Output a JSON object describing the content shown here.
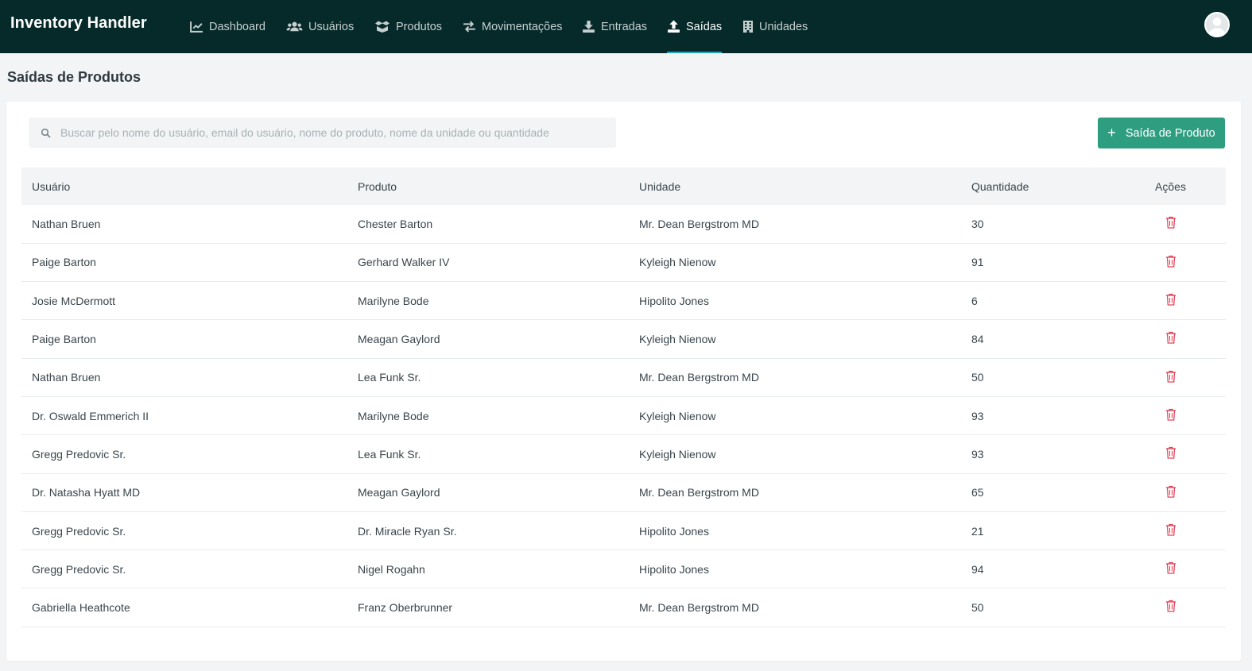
{
  "app": {
    "title": "Inventory Handler"
  },
  "nav": [
    {
      "label": "Dashboard",
      "icon": "chart-line-icon",
      "active": false
    },
    {
      "label": "Usuários",
      "icon": "users-icon",
      "active": false
    },
    {
      "label": "Produtos",
      "icon": "boxes-icon",
      "active": false
    },
    {
      "label": "Movimentações",
      "icon": "exchange-icon",
      "active": false
    },
    {
      "label": "Entradas",
      "icon": "download-icon",
      "active": false
    },
    {
      "label": "Saídas",
      "icon": "upload-icon",
      "active": true
    },
    {
      "label": "Unidades",
      "icon": "building-icon",
      "active": false
    }
  ],
  "page": {
    "title": "Saídas de Produtos"
  },
  "search": {
    "placeholder": "Buscar pelo nome do usuário, email do usuário, nome do produto, nome da unidade ou quantidade",
    "value": ""
  },
  "add_button": {
    "label": "Saída de Produto"
  },
  "table": {
    "headers": [
      "Usuário",
      "Produto",
      "Unidade",
      "Quantidade",
      "Ações"
    ],
    "rows": [
      [
        "Nathan Bruen",
        "Chester Barton",
        "Mr. Dean Bergstrom MD",
        "30"
      ],
      [
        "Paige Barton",
        "Gerhard Walker IV",
        "Kyleigh Nienow",
        "91"
      ],
      [
        "Josie McDermott",
        "Marilyne Bode",
        "Hipolito Jones",
        "6"
      ],
      [
        "Paige Barton",
        "Meagan Gaylord",
        "Kyleigh Nienow",
        "84"
      ],
      [
        "Nathan Bruen",
        "Lea Funk Sr.",
        "Mr. Dean Bergstrom MD",
        "50"
      ],
      [
        "Dr. Oswald Emmerich II",
        "Marilyne Bode",
        "Kyleigh Nienow",
        "93"
      ],
      [
        "Gregg Predovic Sr.",
        "Lea Funk Sr.",
        "Kyleigh Nienow",
        "93"
      ],
      [
        "Dr. Natasha Hyatt MD",
        "Meagan Gaylord",
        "Mr. Dean Bergstrom MD",
        "65"
      ],
      [
        "Gregg Predovic Sr.",
        "Dr. Miracle Ryan Sr.",
        "Hipolito Jones",
        "21"
      ],
      [
        "Gregg Predovic Sr.",
        "Nigel Rogahn",
        "Hipolito Jones",
        "94"
      ],
      [
        "Gabriella Heathcote",
        "Franz Oberbrunner",
        "Mr. Dean Bergstrom MD",
        "50"
      ]
    ]
  },
  "colors": {
    "topbar": "#062a2a",
    "accent": "#2e9e80",
    "delete": "#e0455a",
    "active_underline": "#2aa3c2"
  }
}
